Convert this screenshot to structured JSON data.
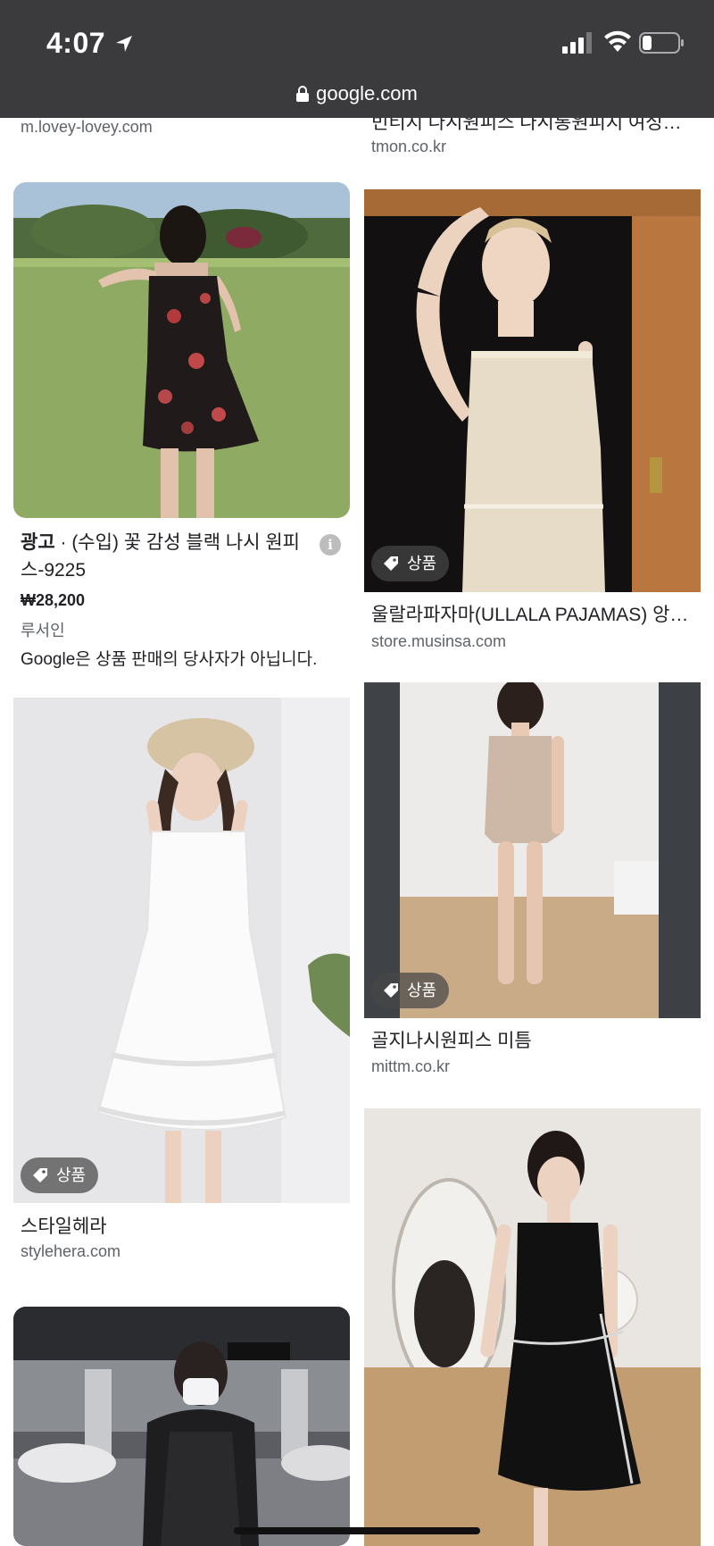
{
  "status_bar": {
    "time": "4:07"
  },
  "url_bar": {
    "domain": "google.com"
  },
  "icons": [
    "location-arrow-icon",
    "signal-icon",
    "wifi-icon",
    "battery-icon",
    "lock-icon",
    "tag-icon",
    "info-icon"
  ],
  "colors": {
    "top_bar": "#3b3b3d",
    "tag_bg": "#464646",
    "domain_text": "#5f6368"
  },
  "tag_label": "상품",
  "left_column": {
    "card0": {
      "domain": "m.lovey-lovey.com"
    },
    "card1": {
      "ad_label": "광고",
      "separator": " · ",
      "title": "(수입) 꽃 감성 블랙 나시 원피스-9225",
      "price": "₩28,200",
      "seller": "루서인",
      "disclaimer": "Google은 상품 판매의 당사자가 아닙니다."
    },
    "card2": {
      "title": "스타일헤라",
      "domain": "stylehera.com"
    }
  },
  "right_column": {
    "card0": {
      "title": "빈티지 나시원피스 나시롱원피지 여성원…",
      "domain": "tmon.co.kr"
    },
    "card1": {
      "title": "울랄라파자마(ULLALA PAJAMAS) 앙…",
      "domain": "store.musinsa.com"
    },
    "card2": {
      "title": "골지나시원피스 미틈",
      "domain": "mittm.co.kr"
    }
  }
}
